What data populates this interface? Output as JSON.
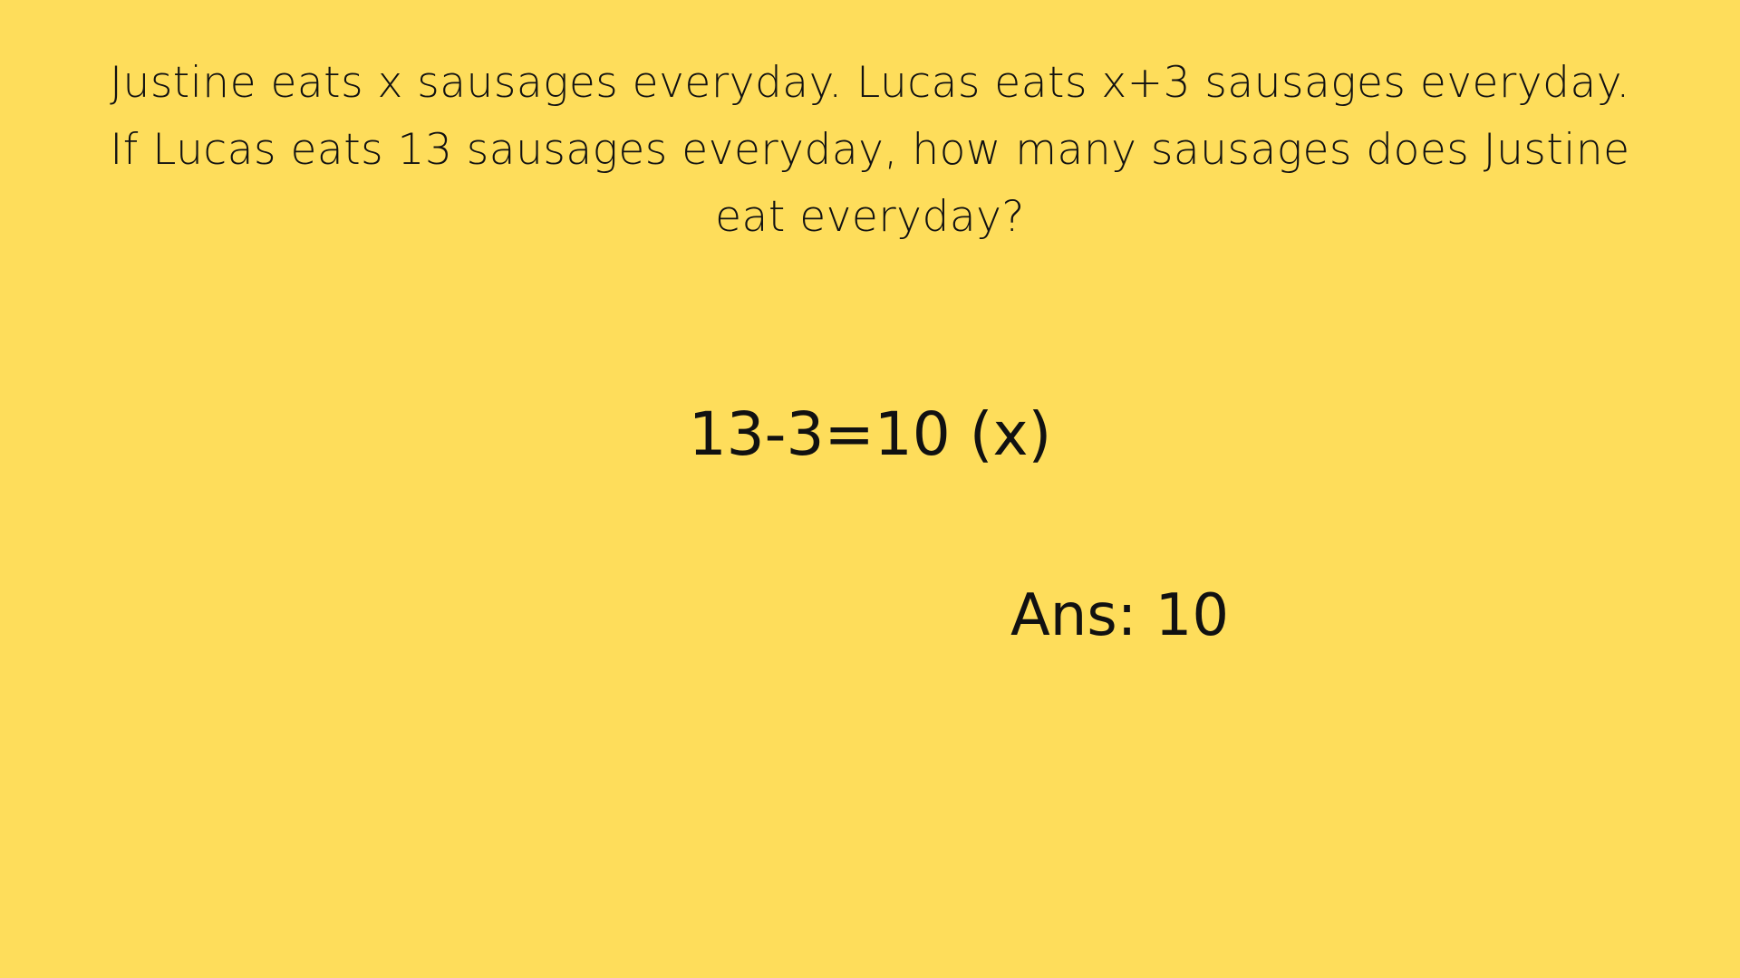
{
  "slide": {
    "background_color": "#FEDD5B",
    "question_lines": [
      "Justine eats x sausages everyday. Lucas eats x+3 sausages everyday.",
      "If Lucas eats 13 sausages everyday, how many sausages does Justine",
      "eat everyday?"
    ],
    "working": "13-3=10 (x)",
    "answer": "Ans: 10"
  }
}
